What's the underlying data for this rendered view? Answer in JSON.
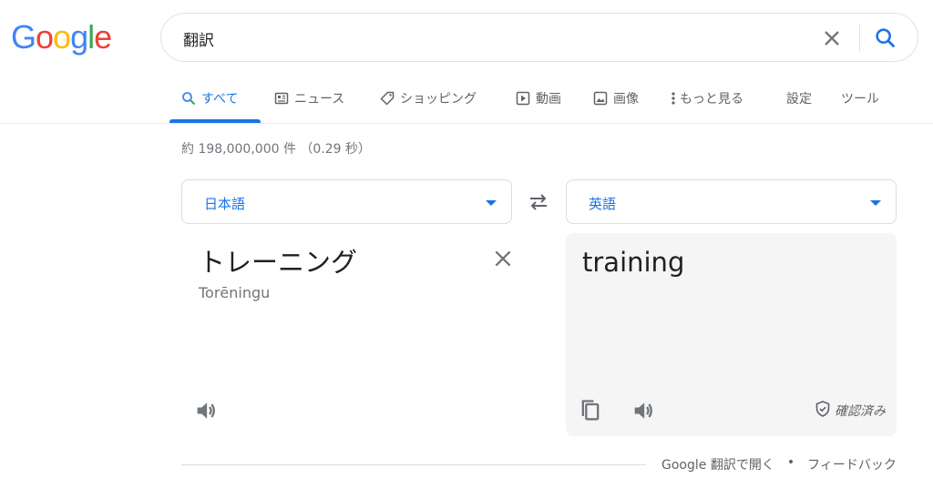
{
  "logo": {
    "letters": [
      "G",
      "o",
      "o",
      "g",
      "l",
      "e"
    ],
    "colors": [
      "#4285f4",
      "#ea4335",
      "#fbbc05",
      "#4285f4",
      "#34a853",
      "#ea4335"
    ]
  },
  "search": {
    "query": "翻訳",
    "clear_icon": "close-icon",
    "search_icon": "search-icon"
  },
  "tabs": [
    {
      "label": "すべて",
      "icon": "search-icon",
      "active": true
    },
    {
      "label": "ニュース",
      "icon": "news-icon"
    },
    {
      "label": "ショッピング",
      "icon": "tag-icon"
    },
    {
      "label": "動画",
      "icon": "play-icon"
    },
    {
      "label": "画像",
      "icon": "image-icon"
    },
    {
      "label": "もっと見る",
      "icon": "more-vert-icon"
    },
    {
      "label": "設定"
    },
    {
      "label": "ツール"
    }
  ],
  "stats": "約 198,000,000 件 （0.29 秒）",
  "translator": {
    "source_lang": "日本語",
    "target_lang": "英語",
    "source_text": "トレーニング",
    "source_romanization": "Torēningu",
    "target_text": "training",
    "verified_label": "確認済み"
  },
  "footer": {
    "open_link": "Google 翻訳で開く",
    "separator": "•",
    "feedback": "フィードバック"
  },
  "colors": {
    "accent": "#1a73e8",
    "icon_gray": "#70757a",
    "target_bg": "#f5f5f5"
  }
}
